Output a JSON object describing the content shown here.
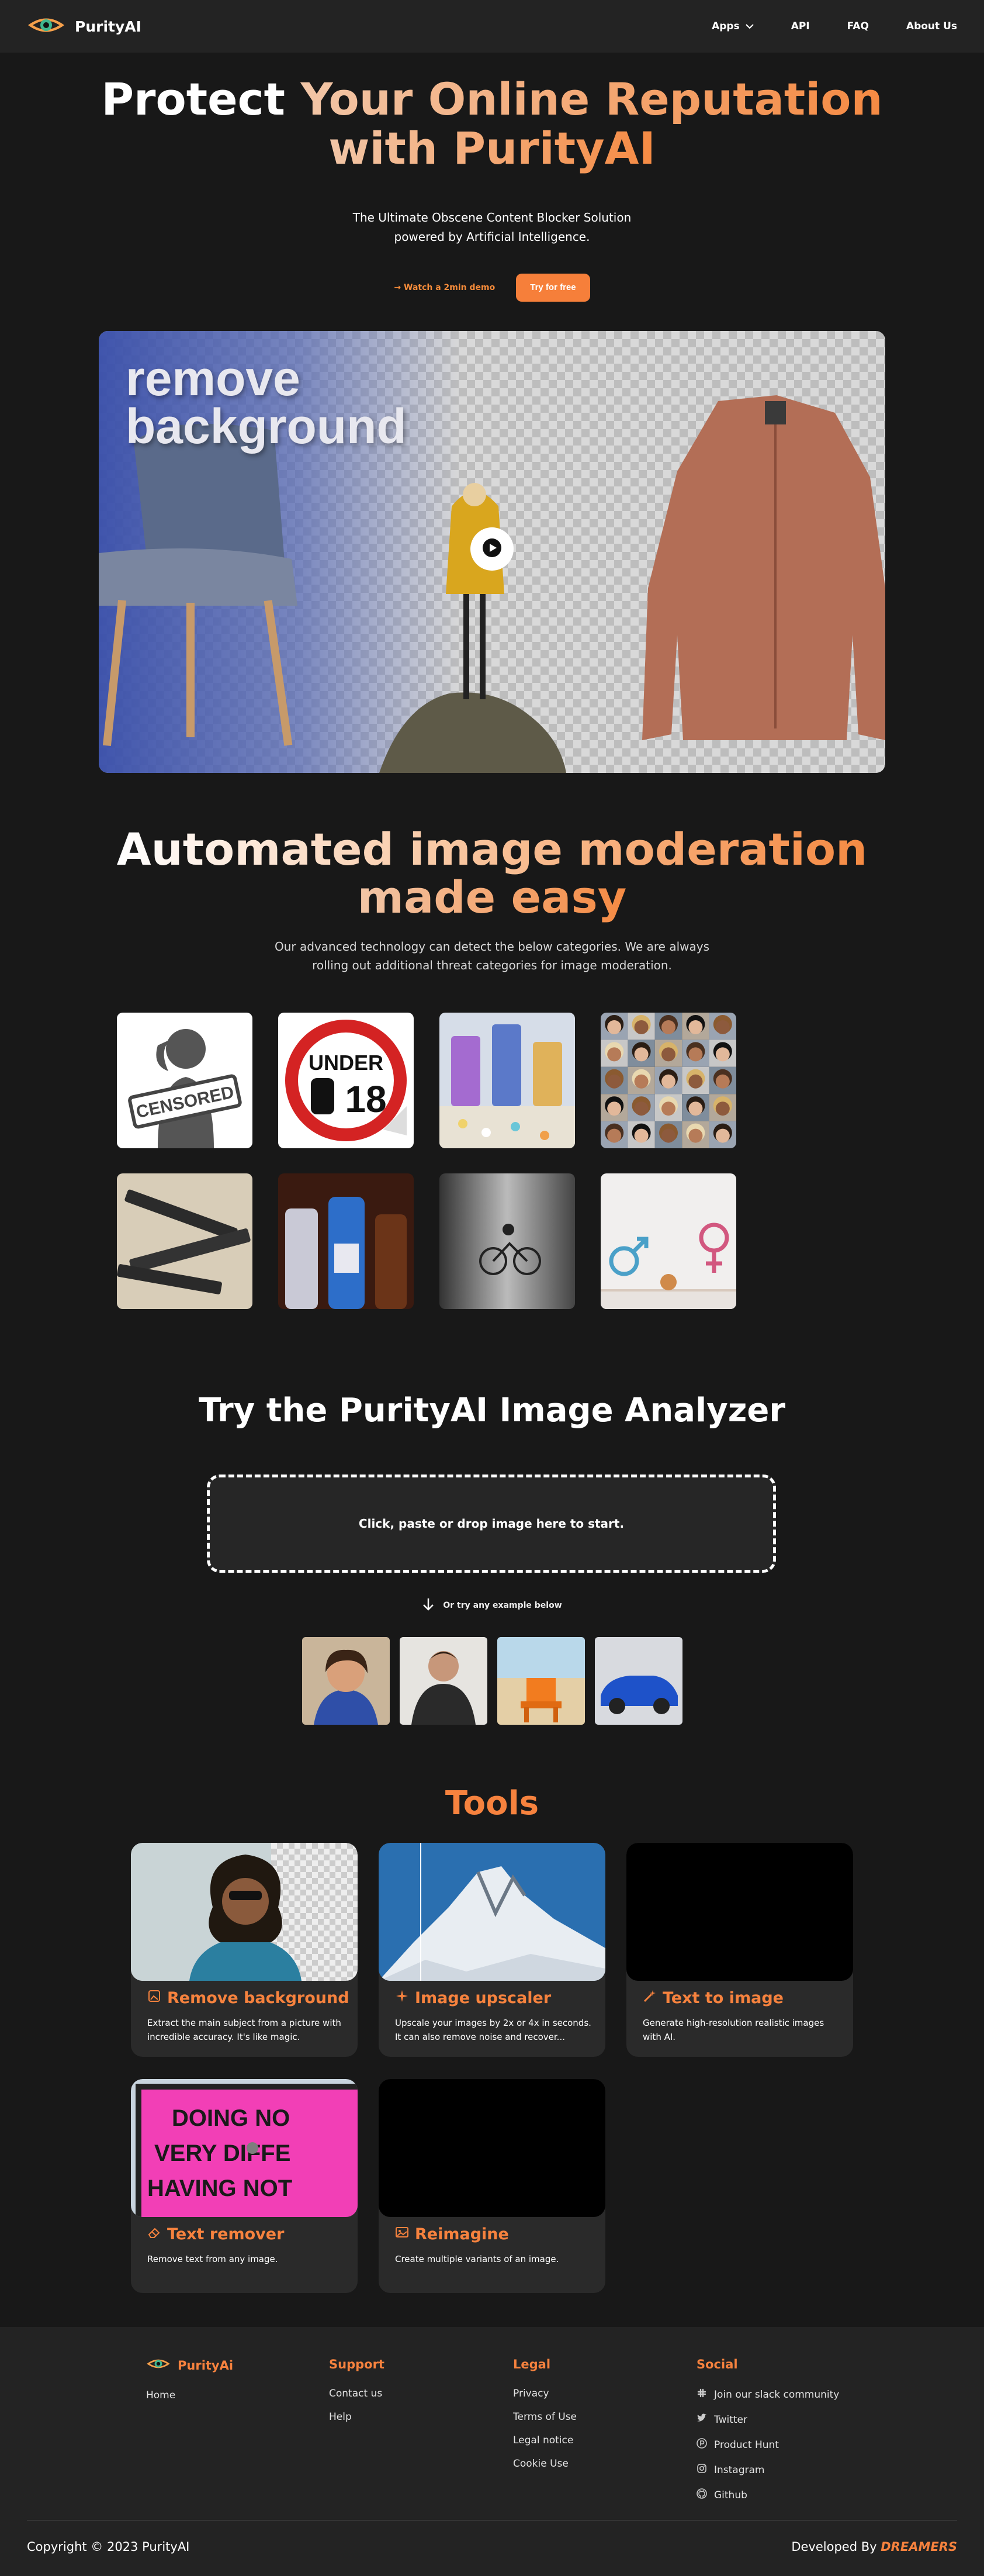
{
  "nav": {
    "brand": "PurityAI",
    "links": [
      "Apps",
      "API",
      "FAQ",
      "About Us"
    ]
  },
  "hero": {
    "title_a": "Protect",
    "title_b": "Your Online Reputation",
    "title_c": "with PurityAI",
    "subtitle_1": "The Ultimate Obscene Content Blocker Solution",
    "subtitle_2": "powered by Artificial Intelligence.",
    "demo_link": "→ Watch a 2min demo",
    "cta": "Try for free",
    "video_overlay_1": "remove",
    "video_overlay_2": "background"
  },
  "moderation": {
    "title_a": "Automated image moderation",
    "title_b": "made easy",
    "desc_1": "Our advanced technology can detect the below categories. We are always",
    "desc_2": "rolling out additional threat categories for image moderation.",
    "badge_censored": "CENSORED",
    "badge_under": "UNDER",
    "badge_18": "18"
  },
  "analyzer": {
    "title": "Try the PurityAI Image Analyzer",
    "dropzone": "Click, paste or drop image here to start.",
    "hint": "Or try any example below"
  },
  "tools": {
    "title": "Tools",
    "cards": [
      {
        "title": "Remove background",
        "desc": "Extract the main subject from a picture with incredible accuracy. It's like magic."
      },
      {
        "title": "Image upscaler",
        "desc": "Upscale your images by 2x or 4x in seconds. It can also remove noise and recover..."
      },
      {
        "title": "Text to image",
        "desc": "Generate high-resolution realistic images with AI."
      },
      {
        "title": "Text remover",
        "desc": "Remove text from any image."
      },
      {
        "title": "Reimagine",
        "desc": "Create multiple variants of an image."
      }
    ],
    "billboard_lines": [
      "DOING NO",
      "VERY DIFFE",
      "HAVING NOT"
    ]
  },
  "footer": {
    "brand": "PurityAi",
    "brand_links": [
      "Home"
    ],
    "support": {
      "title": "Support",
      "links": [
        "Contact us",
        "Help"
      ]
    },
    "legal": {
      "title": "Legal",
      "links": [
        "Privacy",
        "Terms of Use",
        "Legal notice",
        "Cookie Use"
      ]
    },
    "social": {
      "title": "Social",
      "links": [
        "Join our slack community",
        "Twitter",
        "Product Hunt",
        "Instagram",
        "Github"
      ]
    },
    "copyright": "Copyright © 2023 PurityAI",
    "developed_by": "Developed By",
    "developer": "DREAMERS"
  },
  "colors": {
    "accent": "#f6823e",
    "background": "#181818",
    "surface": "#232323"
  }
}
